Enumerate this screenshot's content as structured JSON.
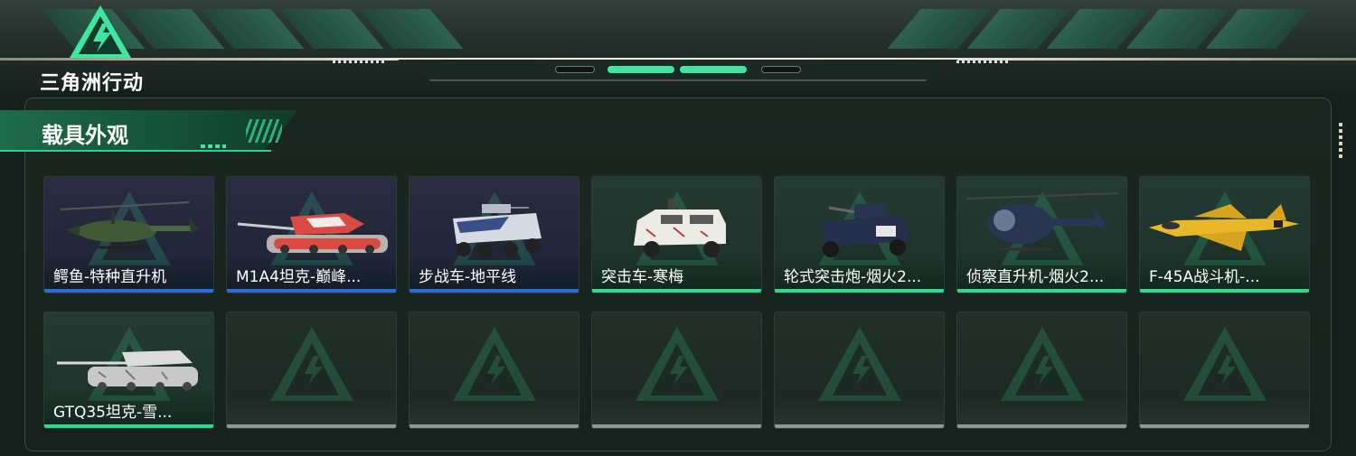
{
  "brand": {
    "logo_text": "三角洲行动",
    "accent_color": "#3ee6a0"
  },
  "section": {
    "title": "载具外观"
  },
  "vehicles": [
    {
      "name": "鳄鱼-特种直升机",
      "rarity_color": "#2f6bd8",
      "icon": "helicopter-icon"
    },
    {
      "name": "M1A4坦克-巅峰...",
      "rarity_color": "#2f6bd8",
      "icon": "tank-icon"
    },
    {
      "name": "步战车-地平线",
      "rarity_color": "#2f6bd8",
      "icon": "ifv-icon"
    },
    {
      "name": "突击车-寒梅",
      "rarity_color": "#34d68c",
      "icon": "assault-vehicle-icon"
    },
    {
      "name": "轮式突击炮-烟火2...",
      "rarity_color": "#34d68c",
      "icon": "wheeled-gun-icon"
    },
    {
      "name": "侦察直升机-烟火2...",
      "rarity_color": "#34d68c",
      "icon": "scout-helicopter-icon"
    },
    {
      "name": "F-45A战斗机-...",
      "rarity_color": "#34d68c",
      "icon": "fighter-jet-icon"
    },
    {
      "name": "GTQ35坦克-雪...",
      "rarity_color": "#34d68c",
      "icon": "tank-icon"
    }
  ],
  "empty_slot_count": 6
}
